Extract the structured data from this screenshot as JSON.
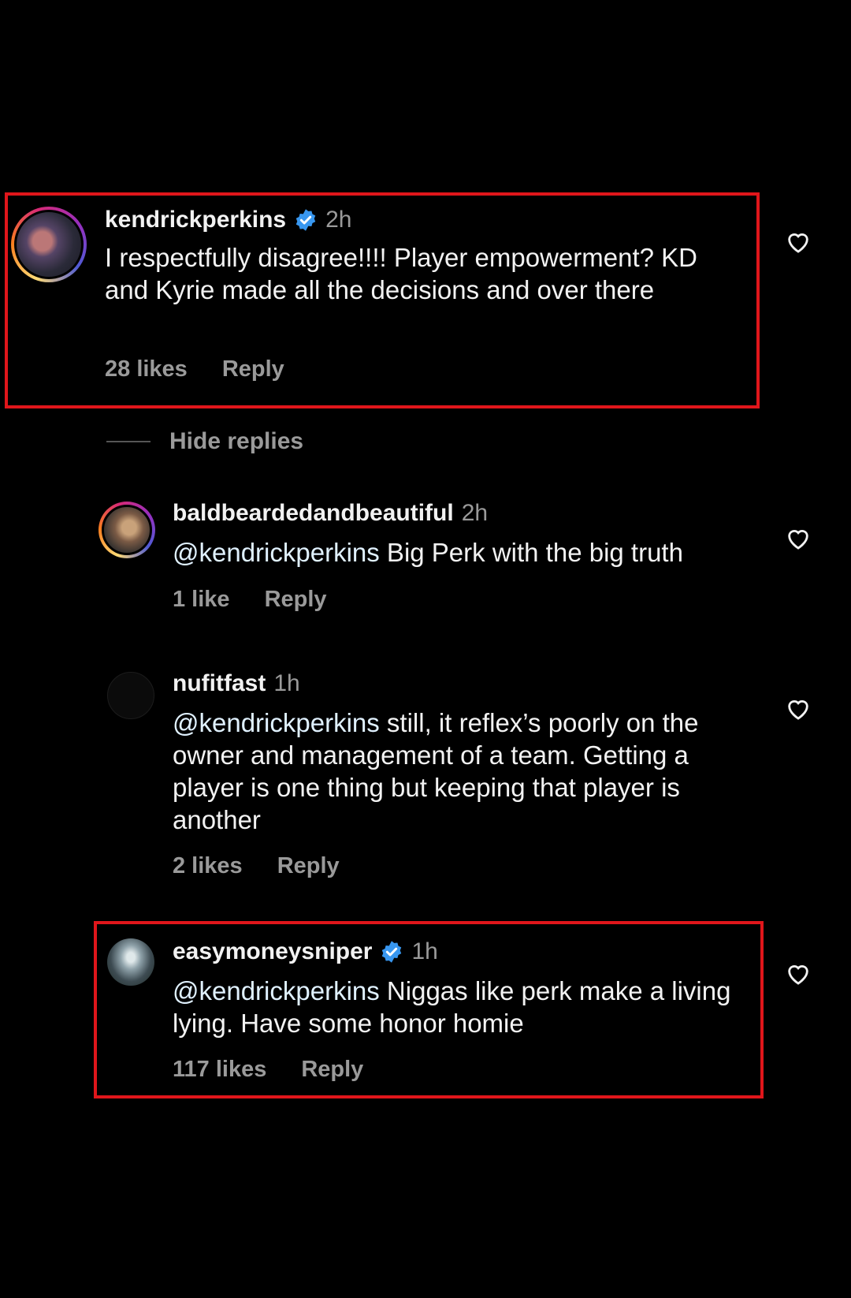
{
  "comments": [
    {
      "username": "kendrickperkins",
      "time": "2h",
      "text": "I respectfully disagree!!!! Player empowerment? KD and Kyrie made all the decisions and over there",
      "likes": "28 likes",
      "reply": "Reply",
      "verified": true
    },
    {
      "username": "baldbeardedandbeautiful",
      "time": "2h",
      "mention": "@kendrickperkins",
      "text": " Big Perk with the big truth",
      "likes": "1 like",
      "reply": "Reply"
    },
    {
      "username": "nufitfast",
      "time": "1h",
      "mention": "@kendrickperkins",
      "text": " still, it reflex’s poorly on the owner and management of a team. Getting a player is one thing but keeping that player is another",
      "likes": "2 likes",
      "reply": "Reply"
    },
    {
      "username": "easymoneysniper",
      "time": "1h",
      "mention": "@kendrickperkins",
      "text": " Niggas like perk make a living lying. Have some honor homie",
      "likes": "117 likes",
      "reply": "Reply",
      "verified": true
    }
  ],
  "hide_replies": "Hide replies",
  "colors": {
    "background": "#000000",
    "highlight": "#e0161b",
    "verified": "#3897f0",
    "muted": "#9a9a9a"
  }
}
